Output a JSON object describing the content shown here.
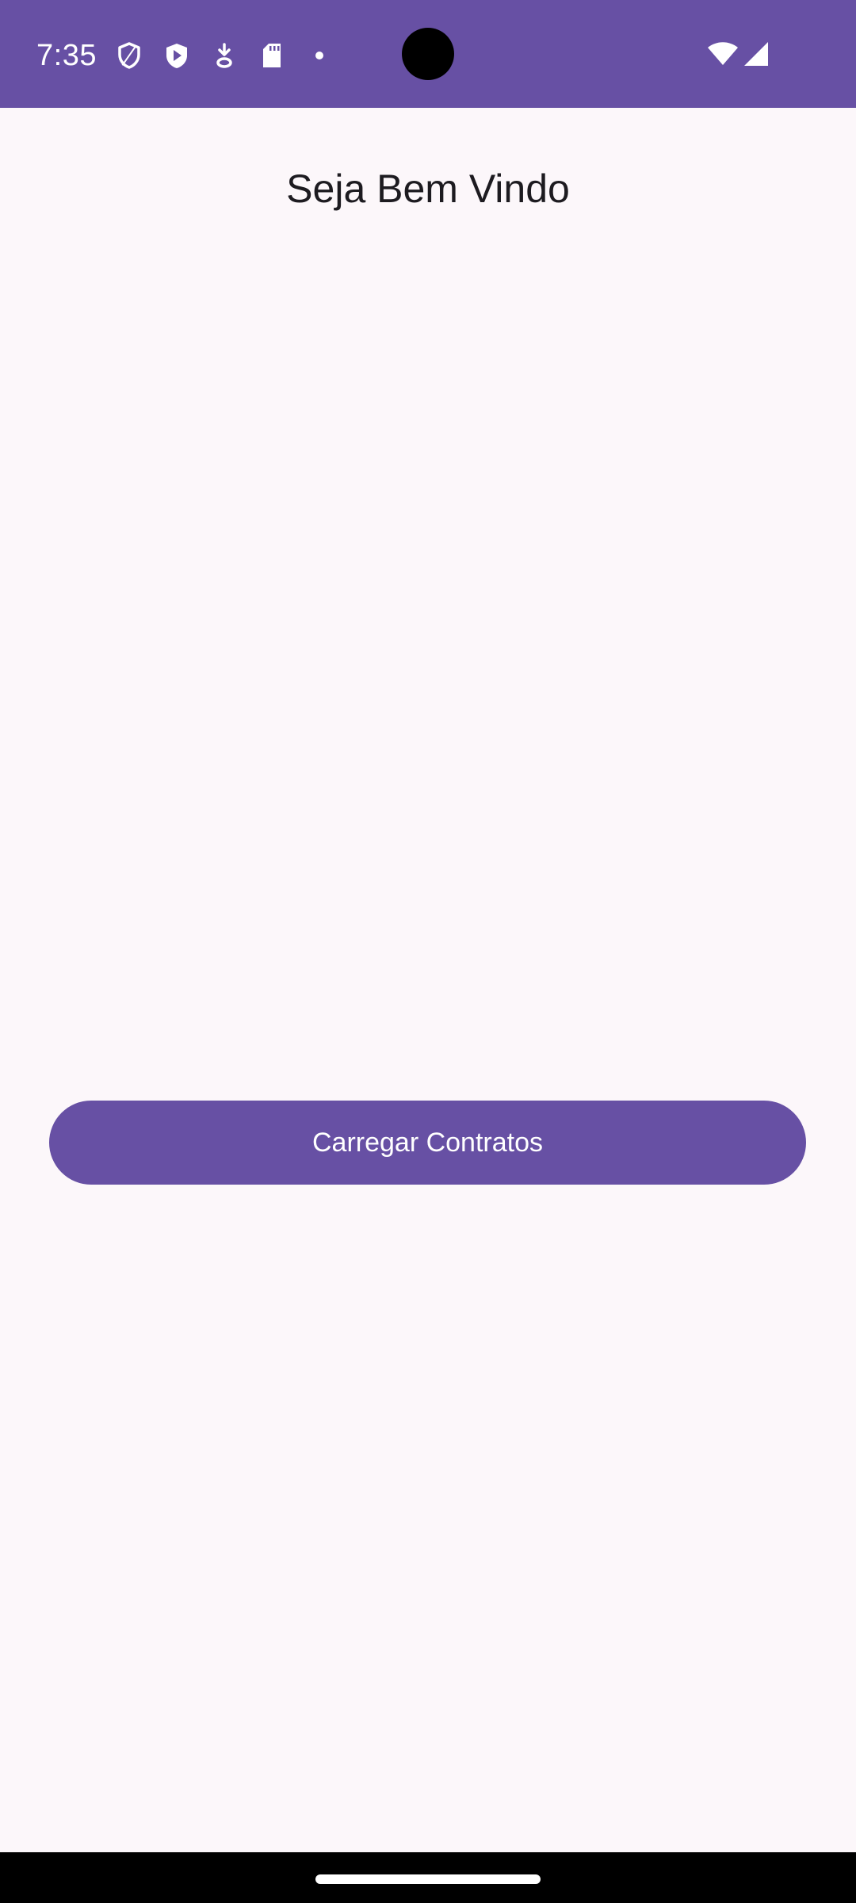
{
  "status_bar": {
    "time": "7:35",
    "background_color": "#6750A4",
    "left_icons": [
      "shield-icon",
      "play-store-icon",
      "download-icon",
      "sd-card-icon",
      "dot-icon"
    ],
    "right_icons": [
      "wifi-icon",
      "cell-signal-icon"
    ]
  },
  "main": {
    "title": "Seja Bem Vindo",
    "load_button_label": "Carregar Contratos",
    "accent_color": "#6750A4",
    "background_color": "#FCF7FA"
  },
  "nav_bar": {
    "icons": [
      "home-handle"
    ]
  }
}
